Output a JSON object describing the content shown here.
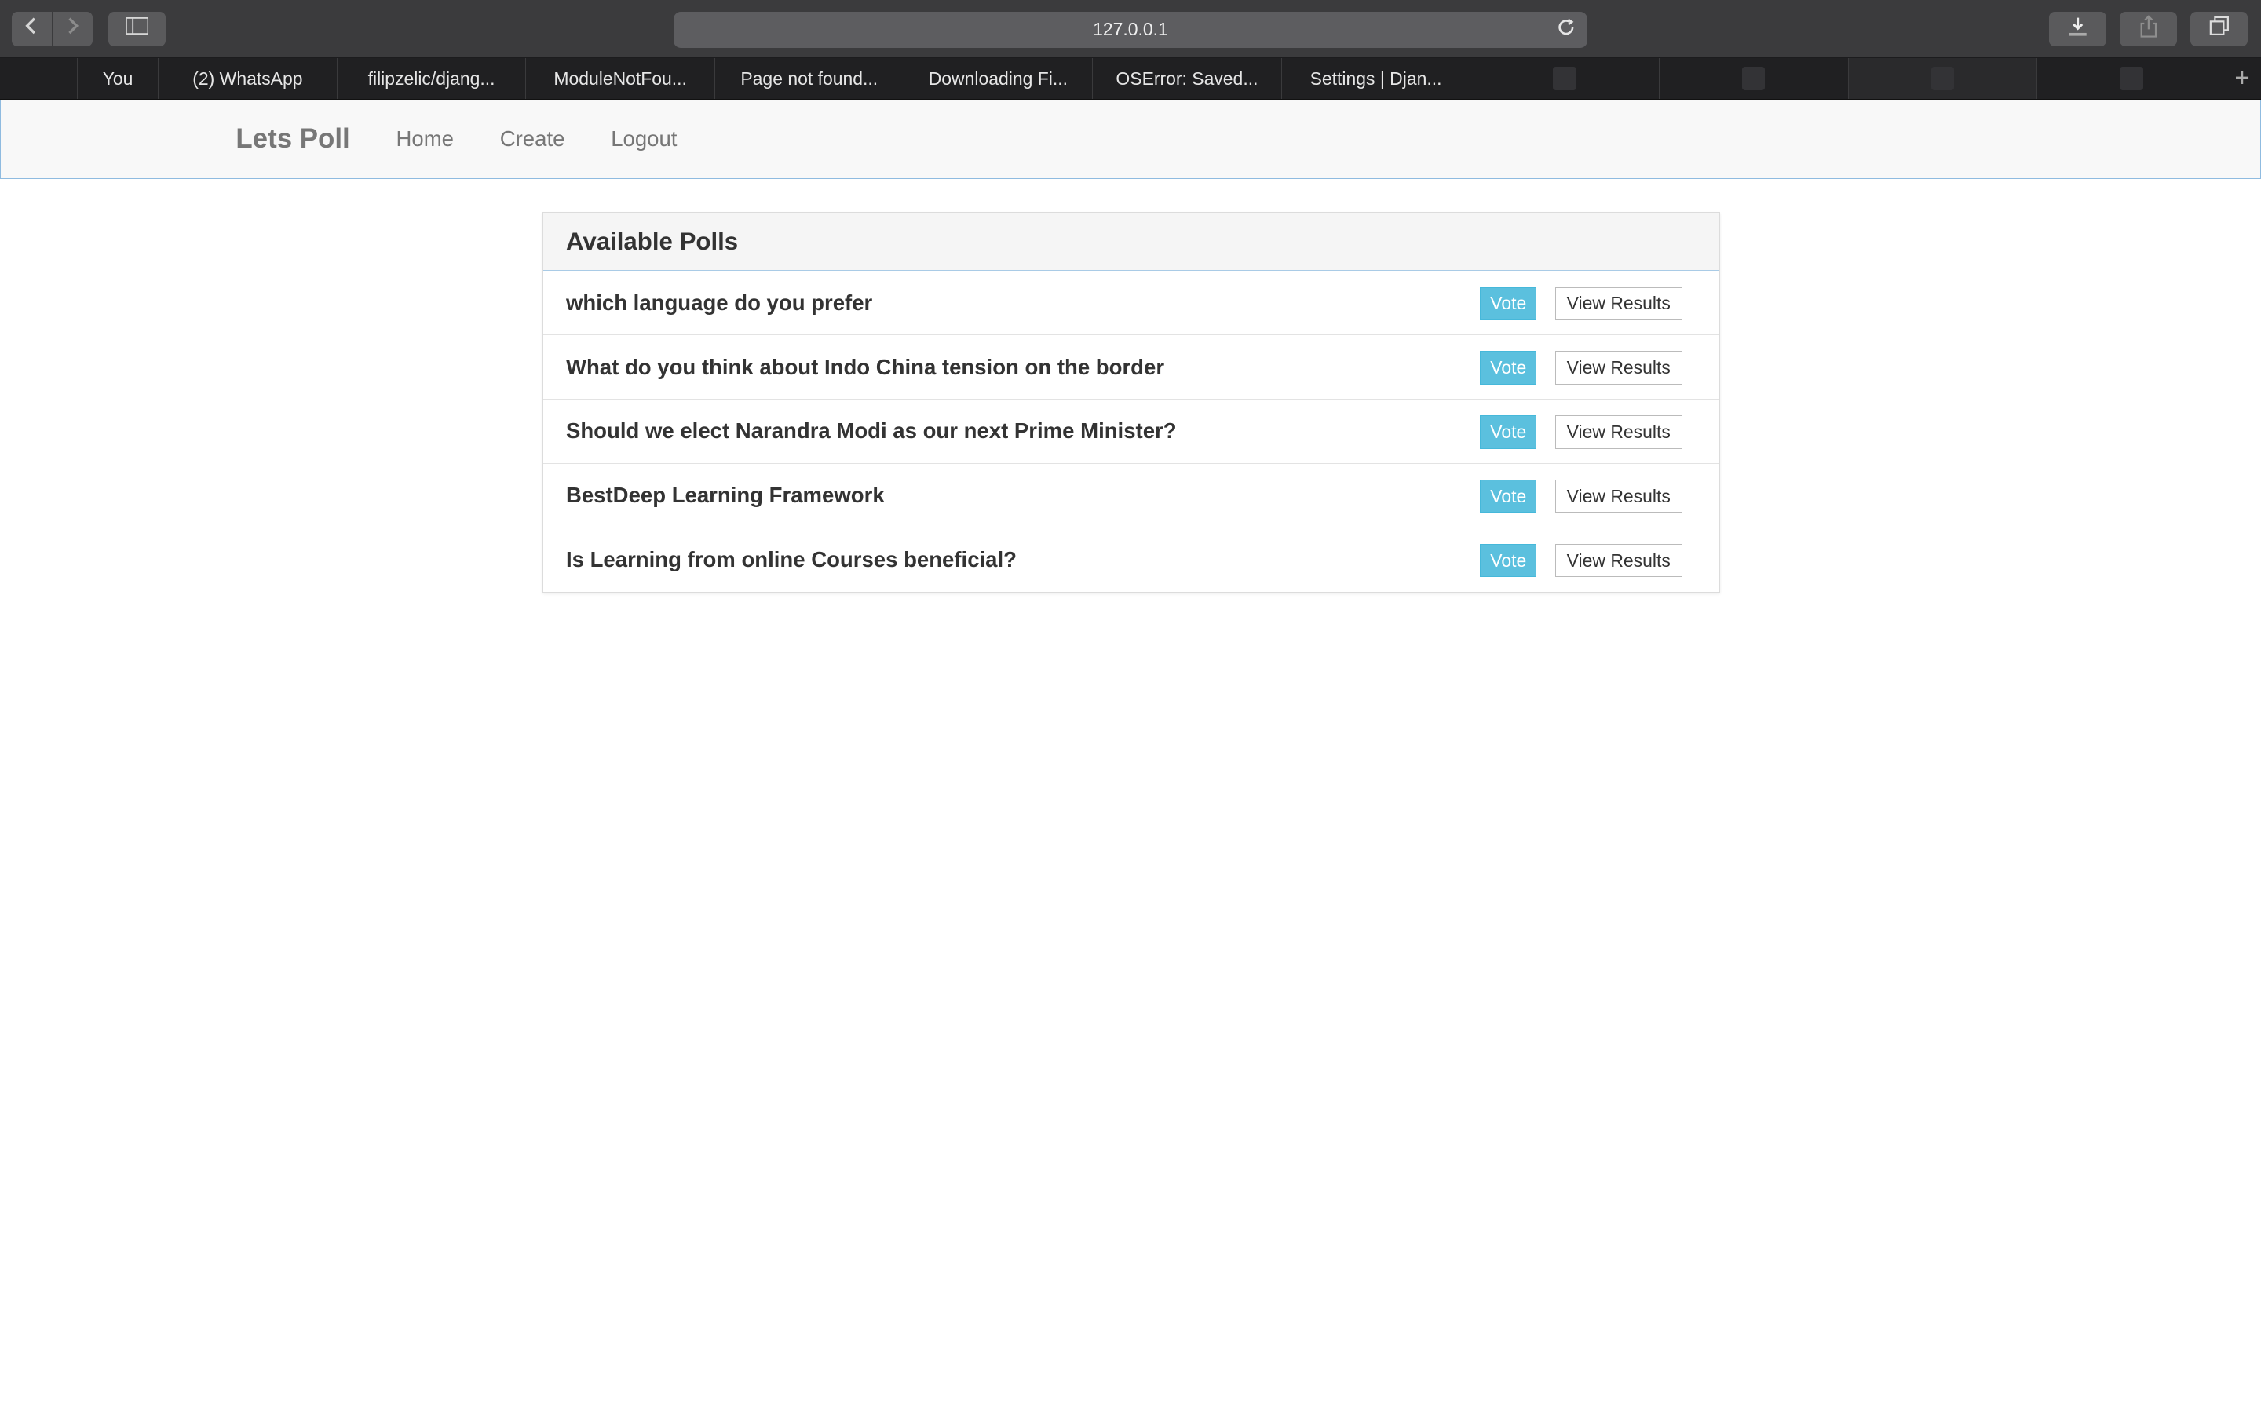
{
  "browser": {
    "url": "127.0.0.1",
    "tabs": [
      {
        "label": "",
        "width": 22
      },
      {
        "label": "",
        "width": 32
      },
      {
        "label": "You",
        "width": 56
      },
      {
        "label": "(2) WhatsApp",
        "width": 124
      },
      {
        "label": "filipzelic/djang...",
        "width": 131
      },
      {
        "label": "ModuleNotFou...",
        "width": 131
      },
      {
        "label": "Page not found...",
        "width": 131
      },
      {
        "label": "Downloading Fi...",
        "width": 131
      },
      {
        "label": "OSError: Saved...",
        "width": 131
      },
      {
        "label": "Settings | Djan...",
        "width": 131
      },
      {
        "label": "",
        "width": 131
      },
      {
        "label": "",
        "width": 131
      },
      {
        "label": "",
        "width": 131
      },
      {
        "label": "",
        "width": 131
      }
    ]
  },
  "navbar": {
    "brand": "Lets Poll",
    "links": [
      "Home",
      "Create",
      "Logout"
    ]
  },
  "polls": {
    "heading": "Available Polls",
    "vote_label": "Vote",
    "results_label": "View Results",
    "items": [
      "which language do you prefer",
      "What do you think about Indo China tension on the border",
      "Should we elect Narandra Modi as our next Prime Minister?",
      "BestDeep Learning Framework",
      "Is Learning from online Courses beneficial?"
    ]
  }
}
